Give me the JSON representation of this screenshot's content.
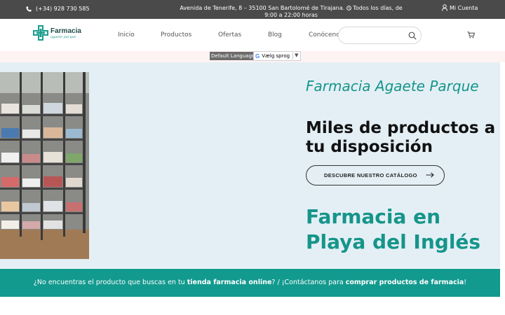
{
  "topbar": {
    "phone": "(+34) 928 730 585",
    "address": "Avenida de Tenerife, 8 – 35100 San Bartolomé de Tirajana.",
    "hours": "Todos los días, de 9:00 a 22:00 horas",
    "account": "Mi Cuenta"
  },
  "logo": {
    "brand": "Farmacia",
    "sub": "agaete parque"
  },
  "menu": {
    "items": [
      {
        "label": "Inicio"
      },
      {
        "label": "Productos"
      },
      {
        "label": "Ofertas"
      },
      {
        "label": "Blog"
      },
      {
        "label": "Conócenos"
      }
    ]
  },
  "search": {
    "placeholder": ""
  },
  "language": {
    "default_label": "Default Language",
    "select_value": "Vælg sprog"
  },
  "hero": {
    "subtitle": "Farmacia Agaete Parque",
    "title": "Miles de productos a tu disposición",
    "button_label": "DESCUBRE NUESTRO CATÁLOGO",
    "headline": "Farmacia en Playa del Inglés"
  },
  "banner": {
    "text_1": "¿No encuentras el producto que buscas en tu ",
    "bold_1": "tienda farmacia online",
    "text_2": "? / ¡Contáctanos para ",
    "bold_2": "comprar productos de farmacia",
    "text_3": "!"
  },
  "colors": {
    "accent": "#15958a",
    "topbar": "#4a4a4a",
    "hero_bg": "#e4eff5",
    "banner": "#139a8f"
  },
  "icons": {
    "phone": "phone-icon",
    "clock": "clock-icon",
    "user": "user-icon",
    "search": "search-icon",
    "cart": "cart-icon",
    "arrow": "arrow-right-icon",
    "google": "google-icon"
  }
}
